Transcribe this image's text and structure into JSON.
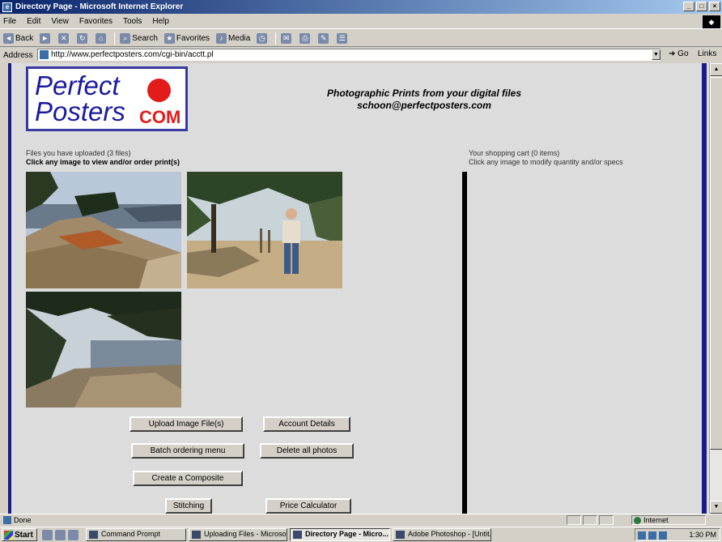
{
  "window": {
    "title": "Directory Page - Microsoft Internet Explorer",
    "controls": [
      "_",
      "□",
      "×"
    ]
  },
  "menu": [
    "File",
    "Edit",
    "View",
    "Favorites",
    "Tools",
    "Help"
  ],
  "toolbar": {
    "back": "Back",
    "search": "Search",
    "favorites": "Favorites",
    "media": "Media"
  },
  "address": {
    "label": "Address",
    "url": "http://www.perfectposters.com/cgi-bin/acctt.pl",
    "go": "Go",
    "links": "Links"
  },
  "page": {
    "logo": {
      "line1": "Perfect",
      "line2": "Posters",
      "com": "COM"
    },
    "headline": "Photographic Prints from your digital files",
    "email": "schoon@perfectposters.com",
    "uploaded_info": "Files you have uploaded (3 files)",
    "uploaded_cta": "Click any image to view and/or order print(s)",
    "cart_info": "Your shopping cart (0 items)",
    "cart_cta": "Click any image to modify quantity and/or specs",
    "buttons": {
      "upload": "Upload Image File(s)",
      "account": "Account Details",
      "batch": "Batch ordering menu",
      "delete_all": "Delete all photos",
      "composite": "Create a Composite",
      "stitching": "Stitching",
      "price": "Price Calculator"
    }
  },
  "status": {
    "text": "Done",
    "zone": "Internet"
  },
  "taskbar": {
    "start": "Start",
    "tasks": [
      "Command Prompt",
      "Uploading Files - Microsof...",
      "Directory Page - Micro...",
      "Adobe Photoshop - [Untit..."
    ],
    "clock": "1:30 PM"
  }
}
